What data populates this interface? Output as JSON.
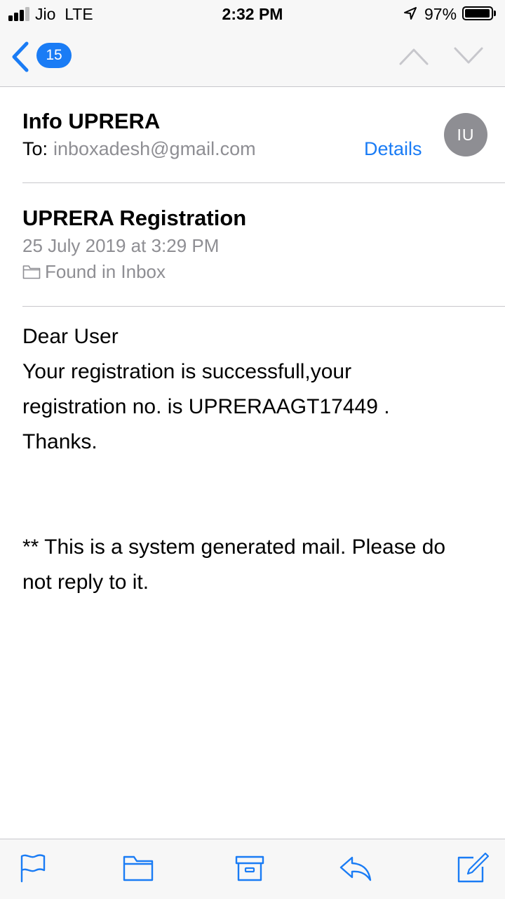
{
  "status_bar": {
    "carrier": "Jio",
    "network": "LTE",
    "time": "2:32 PM",
    "battery_percent": "97%",
    "battery_level": 0.97,
    "signal_bars_filled": 3,
    "signal_bars_total": 4
  },
  "nav": {
    "back_icon": "chevron-left-icon",
    "unread_count": "15",
    "prev_icon": "chevron-up-icon",
    "next_icon": "chevron-down-icon"
  },
  "message": {
    "sender": "Info UPRERA",
    "to_label": "To:",
    "to_address": "inboxadesh@gmail.com",
    "details_label": "Details",
    "avatar_initials": "IU",
    "subject": "UPRERA Registration",
    "date": "25 July 2019 at 3:29 PM",
    "mailbox_label": "Found in Inbox",
    "body": {
      "line1": "Dear User",
      "line2": "Your registration is successfull,your",
      "line3": "registration no. is UPRERAAGT17449 .",
      "line4": "Thanks.",
      "line5": "** This is a system generated mail. Please do",
      "line6": "not reply to it."
    }
  },
  "toolbar": {
    "icons": [
      "flag-icon",
      "folder-icon",
      "archive-icon",
      "reply-icon",
      "compose-icon"
    ]
  },
  "colors": {
    "accent": "#1a7cf5",
    "secondary_text": "#8e8e93",
    "bar_background": "#f7f7f7",
    "separator": "#c8c7cc",
    "avatar_bg": "#8e8e93"
  }
}
